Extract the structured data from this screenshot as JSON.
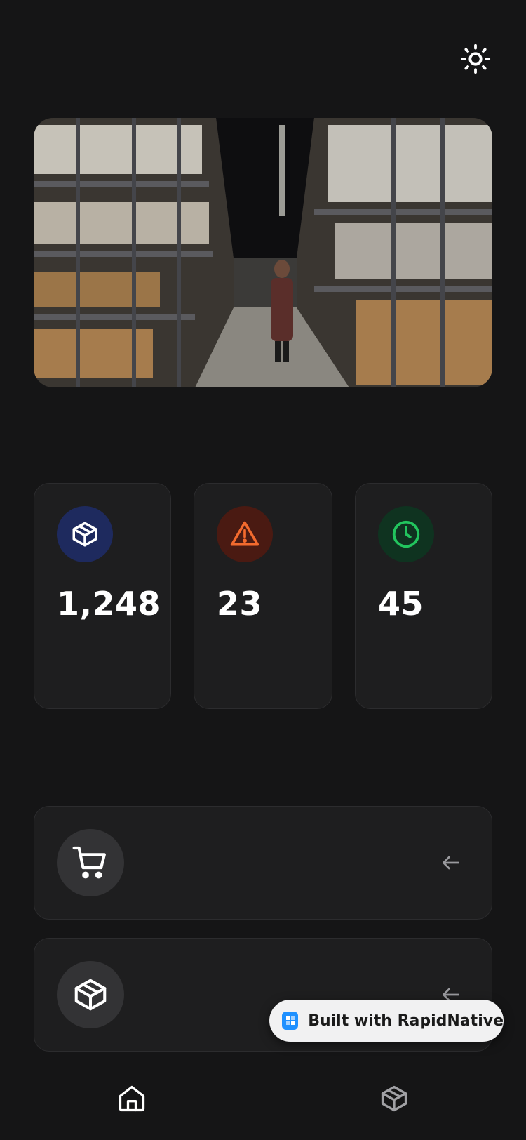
{
  "header": {
    "theme_toggle_icon": "sun-icon"
  },
  "hero": {
    "image": "warehouse-aisle-photo"
  },
  "stats": [
    {
      "icon": "package-icon",
      "value": "1,248",
      "icon_bg": "#1e2a5e",
      "icon_color": "#9fb4ff"
    },
    {
      "icon": "alert-triangle-icon",
      "value": "23",
      "icon_bg": "#4a1a12",
      "icon_color": "#f26a2e"
    },
    {
      "icon": "clock-icon",
      "value": "45",
      "icon_bg": "#0f3320",
      "icon_color": "#22c55e"
    }
  ],
  "actions": [
    {
      "icon": "shopping-cart-icon",
      "arrow_icon": "arrow-left-icon"
    },
    {
      "icon": "package-icon",
      "arrow_icon": "arrow-left-icon"
    }
  ],
  "bottom_nav": [
    {
      "icon": "home-icon",
      "active": true
    },
    {
      "icon": "package-icon",
      "active": false
    }
  ],
  "badge": {
    "label": "Built with RapidNative",
    "logo": "rapidnative-logo-icon"
  },
  "colors": {
    "background": "#151516",
    "card": "#1e1e1f",
    "card_border": "#2c2c2e"
  }
}
